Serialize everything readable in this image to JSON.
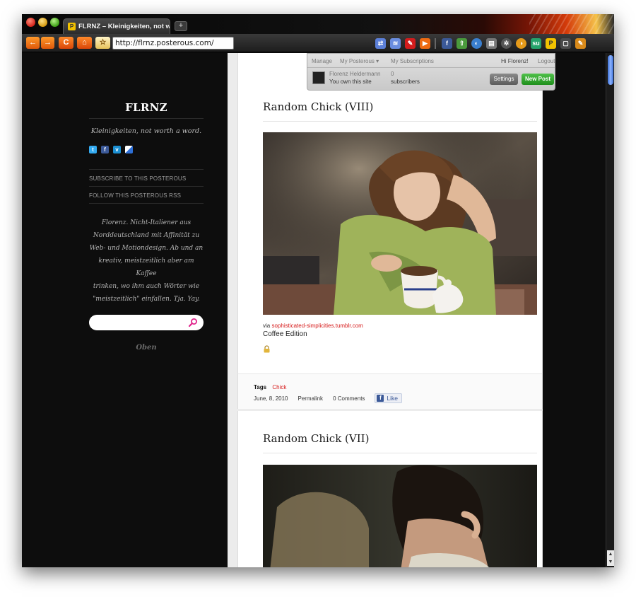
{
  "browser": {
    "tab_title": "FLRNZ – Kleinigkeiten, not w",
    "url": "http://flrnz.posterous.com/",
    "posterous_label": "posterous"
  },
  "admin": {
    "manage": "Manage",
    "my_posterous": "My Posterous ▾",
    "my_subscriptions": "My Subscriptions",
    "greeting": "Hi Florenz!",
    "logout": "Logout",
    "user_name": "Florenz Heldermann",
    "ownership": "You own this site",
    "subscriber_count": "0",
    "subscribers_label": "subscribers",
    "settings": "Settings",
    "new_post": "New Post"
  },
  "sidebar": {
    "blog_title": "FLRNZ",
    "tagline": "Kleinigkeiten, not worth a word.",
    "subscribe": "SUBSCRIBE TO THIS POSTEROUS",
    "follow_rss": "FOLLOW THIS POSTEROUS RSS",
    "bio_lines": [
      "Florenz. Nicht-Italiener aus",
      "Norddeutschland mit Affinität zu",
      "Web- und Motiondesign. Ab und an",
      "kreativ, meistzeitlich aber am Kaffee",
      "trinken, wo ihm auch Wörter wie",
      "\"meistzeitlich\" einfallen. Tja. Yay."
    ],
    "oben": "Oben"
  },
  "posts": [
    {
      "title": "Random Chick (VIII)",
      "via_prefix": "via",
      "via_link": "sophisticated-simplicities.tumblr.com",
      "caption": "Coffee Edition",
      "tags_label": "Tags",
      "tag": "Chick",
      "date": "June, 8, 2010",
      "permalink": "Permalink",
      "comments": "0 Comments",
      "like": "Like"
    },
    {
      "title": "Random Chick (VII)"
    }
  ],
  "colors": {
    "accent_link": "#d61b1b",
    "new_post_green": "#1f8f1c",
    "search_icon": "#e0248c"
  }
}
